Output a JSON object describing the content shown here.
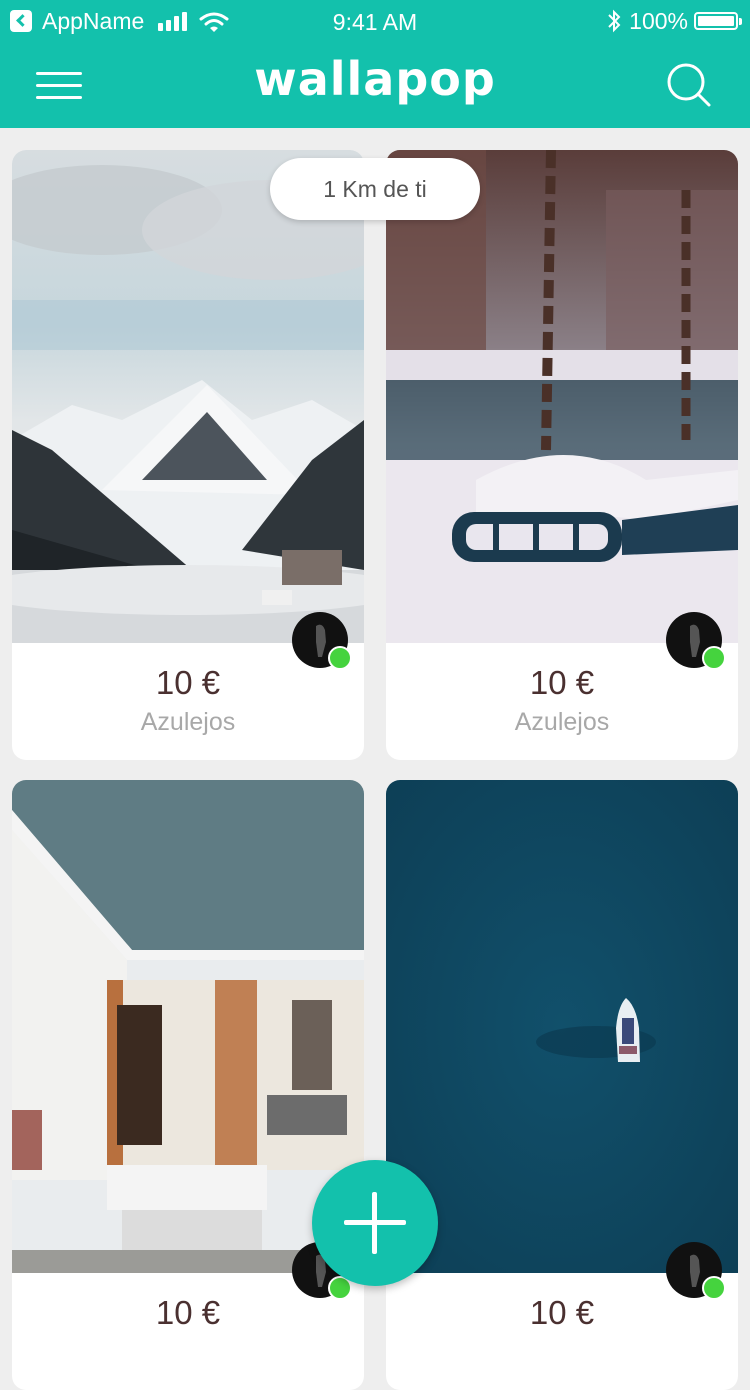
{
  "status_bar": {
    "app_name": "AppName",
    "time": "9:41 AM",
    "battery": "100%"
  },
  "header": {
    "logo": "wallapop",
    "menu_icon": "hamburger-menu-icon",
    "search_icon": "search-icon"
  },
  "distance_label": "1 Km de ti",
  "products": [
    {
      "price": "10 €",
      "title": "Azulejos",
      "image": "snowy-mountain-photo"
    },
    {
      "price": "10 €",
      "title": "Azulejos",
      "image": "snowy-swing-photo"
    },
    {
      "price": "10 €",
      "title": "",
      "image": "white-house-porch-photo"
    },
    {
      "price": "10 €",
      "title": "",
      "image": "boat-on-sea-photo"
    }
  ],
  "fab_icon": "plus-icon",
  "colors": {
    "brand": "#13c1ac",
    "online": "#45d33e",
    "price": "#4a3030",
    "subtitle": "#a8a8a8",
    "background": "#eeeeee"
  }
}
